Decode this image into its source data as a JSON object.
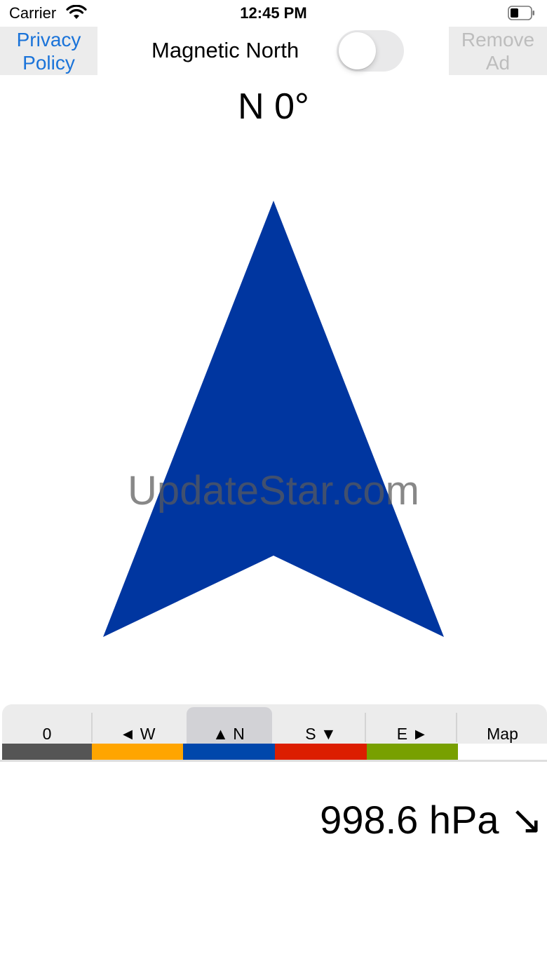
{
  "status_bar": {
    "carrier": "Carrier",
    "time": "12:45 PM",
    "icons": [
      "wifi-icon",
      "battery-icon"
    ]
  },
  "top_bar": {
    "privacy_label": "Privacy\nPolicy",
    "magnetic_label": "Magnetic North",
    "magnetic_toggle_on": false,
    "remove_ad_label": "Remove\nAd"
  },
  "heading": "N 0°",
  "arrow": {
    "icon": "north-arrow-icon",
    "color": "#0036a0"
  },
  "watermark": "UpdateStar.com",
  "segments": [
    {
      "label": "0",
      "color": "#555555"
    },
    {
      "label": "◄ W",
      "color": "#ffa500"
    },
    {
      "label": "▲ N",
      "color": "#0047ab",
      "selected": true
    },
    {
      "label": "S ▼",
      "color": "#dc1e00"
    },
    {
      "label": "E ►",
      "color": "#78a000"
    },
    {
      "label": "Map",
      "color": "#ffffff"
    }
  ],
  "pressure": "998.6 hPa ↘",
  "colors": {
    "accent_link": "#1a73d9",
    "disabled_text": "#bdbdbd",
    "button_bg": "#ececec"
  }
}
